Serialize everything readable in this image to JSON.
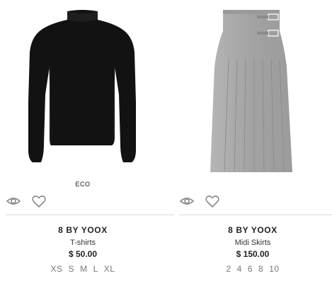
{
  "products": [
    {
      "badge": "ECO",
      "brand": "8 BY YOOX",
      "category": "T-shirts",
      "price": "$ 50.00",
      "sizes": [
        "XS",
        "S",
        "M",
        "L",
        "XL"
      ],
      "image_color": "#111111",
      "icons": [
        "eye-icon",
        "heart-icon"
      ]
    },
    {
      "badge": "",
      "brand": "8 BY YOOX",
      "category": "Midi Skirts",
      "price": "$ 150.00",
      "sizes": [
        "2",
        "4",
        "6",
        "8",
        "10"
      ],
      "image_color": "#a8a8a8",
      "icons": [
        "eye-icon",
        "heart-icon"
      ]
    }
  ]
}
